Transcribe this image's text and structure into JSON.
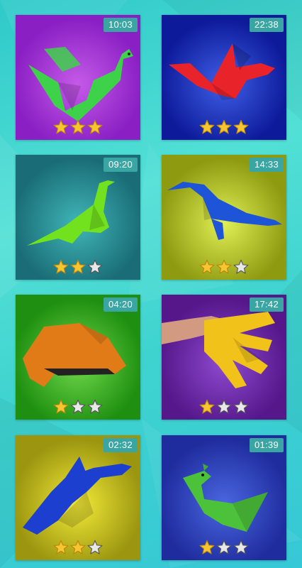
{
  "screen": "origami-dragon-gallery",
  "colors": {
    "badge_bg": "#3aa6a3",
    "star_filled": "#f7c531",
    "star_empty": "#e8e8e8"
  },
  "cards": [
    {
      "id": "dragon-green",
      "time": "10:03",
      "rating": 3,
      "max_rating": 5,
      "bg": "#8a1fc4",
      "bg_glow": "#c55ae8",
      "model_color": "#3ed24a",
      "model": "green-dragon-icon"
    },
    {
      "id": "dragon-red",
      "time": "22:38",
      "rating": 3,
      "max_rating": 5,
      "bg": "#0d1a9a",
      "bg_glow": "#3f5fe6",
      "model_color": "#e8232a",
      "model": "red-dragon-icon"
    },
    {
      "id": "dino-green",
      "time": "09:20",
      "rating": 2,
      "max_rating": 5,
      "bg": "#1a6d77",
      "bg_glow": "#40b6b8",
      "model_color": "#72e21f",
      "model": "green-dinosaur-icon"
    },
    {
      "id": "dino-blue",
      "time": "14:33",
      "rating": 2,
      "max_rating": 5,
      "bg": "#8e9a10",
      "bg_glow": "#e0ef55",
      "model_color": "#1e54d8",
      "model": "blue-dinosaur-icon"
    },
    {
      "id": "dragon-head-orange",
      "time": "04:20",
      "rating": 1,
      "max_rating": 5,
      "bg": "#1f8f11",
      "bg_glow": "#6fd84a",
      "model_color": "#e07b17",
      "model": "orange-dragon-head-icon"
    },
    {
      "id": "dragon-claws-yellow",
      "time": "17:42",
      "rating": 1,
      "max_rating": 5,
      "bg": "#55178a",
      "bg_glow": "#8e4ad0",
      "model_color": "#f0c21a",
      "model": "yellow-claws-icon"
    },
    {
      "id": "dragon-flying-blue",
      "time": "02:32",
      "rating": 2,
      "max_rating": 5,
      "bg": "#9b9510",
      "bg_glow": "#f2ea38",
      "model_color": "#1c3fd0",
      "model": "blue-flying-dragon-icon"
    },
    {
      "id": "bird-green",
      "time": "01:39",
      "rating": 1,
      "max_rating": 5,
      "bg": "#1f2c9e",
      "bg_glow": "#4a67e0",
      "model_color": "#4cc13a",
      "model": "green-bird-icon"
    }
  ]
}
